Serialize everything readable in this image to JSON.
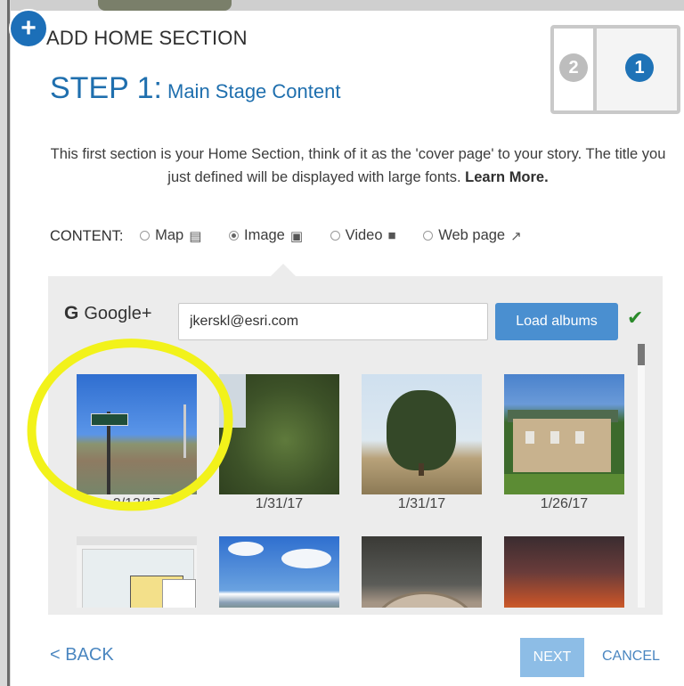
{
  "dialog": {
    "title": "ADD HOME SECTION",
    "step_number": "STEP 1:",
    "step_name": "Main Stage Content",
    "progress": {
      "step_a": "2",
      "step_b": "1",
      "current_step": 1
    },
    "intro_text": "This first section is your Home Section, think of it as the 'cover page' to your story. The title you just defined will be displayed with large fonts.",
    "learn_more": "Learn More."
  },
  "content": {
    "label": "CONTENT:",
    "options": [
      {
        "label": "Map",
        "icon": "map-icon",
        "selected": false
      },
      {
        "label": "Image",
        "icon": "camera-icon",
        "selected": true
      },
      {
        "label": "Video",
        "icon": "video-camera-icon",
        "selected": false
      },
      {
        "label": "Web page",
        "icon": "external-link-icon",
        "selected": false
      }
    ]
  },
  "google": {
    "provider": "Google+",
    "logo": "G",
    "email_value": "jkerskl@esri.com",
    "load_button": "Load albums",
    "status_icon": "checkmark-icon"
  },
  "photos": [
    {
      "date": "2/13/17"
    },
    {
      "date": "1/31/17"
    },
    {
      "date": "1/31/17"
    },
    {
      "date": "1/26/17"
    },
    {
      "date": ""
    },
    {
      "date": ""
    },
    {
      "date": ""
    },
    {
      "date": ""
    }
  ],
  "footer": {
    "back": "< BACK",
    "next": "NEXT",
    "cancel": "CANCEL"
  },
  "colors": {
    "accent": "#1f6fae",
    "button": "#4a8fd0",
    "highlight": "#f2f21a"
  }
}
